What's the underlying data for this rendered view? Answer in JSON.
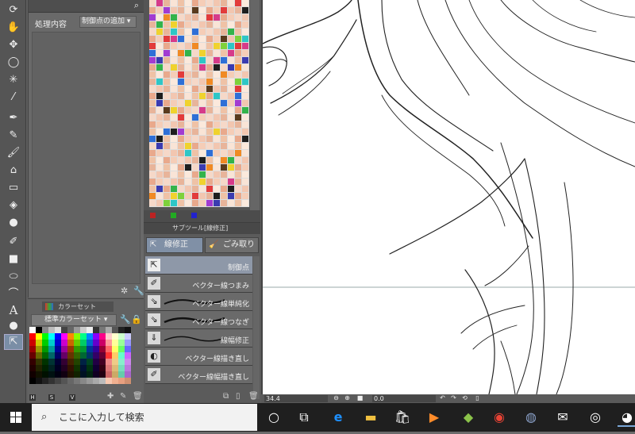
{
  "tool_property": {
    "label": "処理内容",
    "value": "制御点の追加"
  },
  "color_set": {
    "tab_label": "カラーセット",
    "selected_set": "標準カラーセット",
    "hsv": [
      "H",
      "S",
      "V"
    ]
  },
  "sub_tool": {
    "tab_label": "サブツール[線修正]",
    "groups": [
      "線修正",
      "ごみ取り"
    ],
    "items": [
      "制御点",
      "ベクター線つまみ",
      "ベクター線単純化",
      "ベクター線つなぎ",
      "線幅修正",
      "ベクター線描き直し",
      "ベクター線幅描き直し"
    ]
  },
  "canvas_status": {
    "zoom": "34.4",
    "angle": "0.0"
  },
  "taskbar": {
    "search_placeholder": "ここに入力して検索"
  },
  "icons": [
    "move-icon",
    "lasso-icon",
    "eyedropper-icon",
    "pen-icon",
    "pencil-icon",
    "brush-icon",
    "airbrush-icon",
    "eraser-icon",
    "fill-icon",
    "gradient-icon",
    "shape-icon",
    "text-icon",
    "balloon-icon",
    "line-correction-icon"
  ],
  "colors": {
    "panel_bg": "#5e5e5e",
    "toolbar_bg": "#555555",
    "selected_item": "#8e98a8",
    "taskbar": "#1f1f1f"
  }
}
